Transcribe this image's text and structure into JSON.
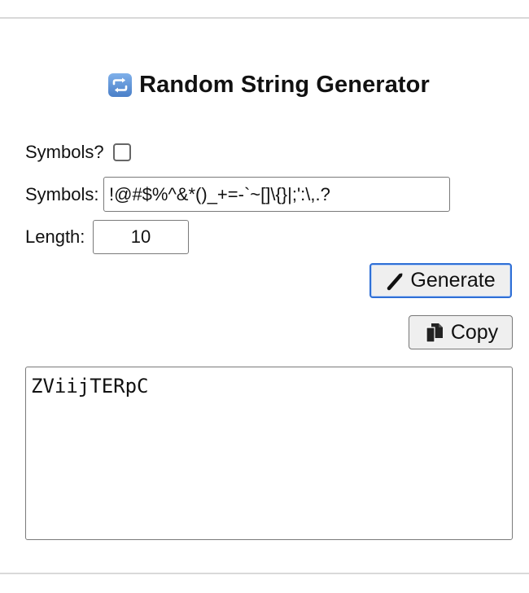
{
  "header": {
    "title": "Random String Generator",
    "title_icon": "repeat-arrows-icon"
  },
  "form": {
    "symbols_toggle_label": "Symbols?",
    "symbols_toggle_checked": false,
    "symbols_label": "Symbols:",
    "symbols_value": "!@#$%^&*()_+=-`~[]\\{}|;':\\,.?",
    "length_label": "Length:",
    "length_value": "10"
  },
  "actions": {
    "generate_label": "Generate",
    "generate_icon": "magic-wand-icon",
    "copy_label": "Copy",
    "copy_icon": "copy-icon"
  },
  "output": {
    "value": "ZViijTERpC"
  },
  "colors": {
    "generate_border": "#2f6fd6",
    "title_icon_bg": "#5b8fd6"
  }
}
